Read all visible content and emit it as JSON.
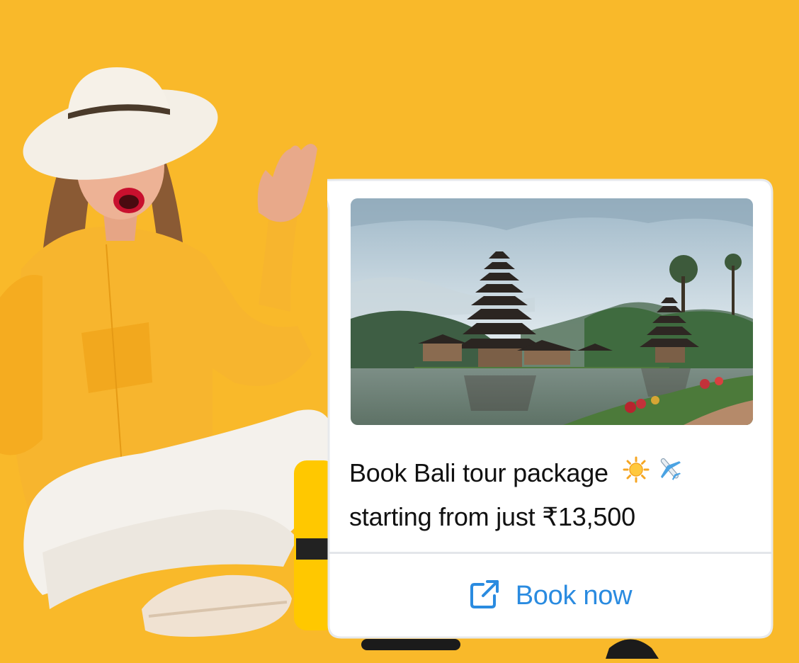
{
  "promo": {
    "caption_line1": "Book Bali tour package",
    "caption_line2": "starting from just ₹13,500",
    "emojis": [
      "sun-emoji",
      "airplane-emoji"
    ],
    "cta_label": "Book now",
    "cta_icon": "external-link-icon"
  },
  "colors": {
    "background": "#F9B92A",
    "card": "#FFFFFF",
    "accent": "#2A8BE0"
  }
}
